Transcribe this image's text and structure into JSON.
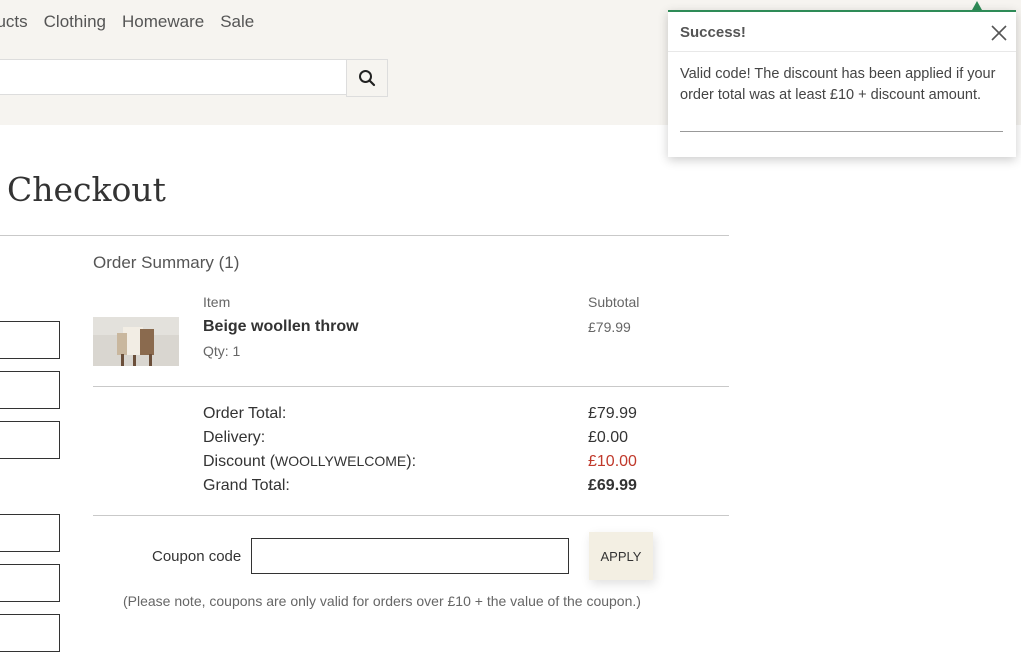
{
  "nav": {
    "items": [
      "ducts",
      "Clothing",
      "Homeware",
      "Sale"
    ]
  },
  "search": {
    "value": "",
    "icon": "search-icon"
  },
  "checkout": {
    "title": "Checkout"
  },
  "summary": {
    "title": "Order Summary (1)",
    "col_item": "Item",
    "col_subtotal": "Subtotal",
    "item": {
      "name": "Beige woollen throw",
      "qty": "Qty: 1",
      "subtotal": "£79.99"
    },
    "order_total_label": "Order Total:",
    "order_total": "£79.99",
    "delivery_label": "Delivery:",
    "delivery": "£0.00",
    "discount_label_prefix": "Discount (",
    "discount_code": "WOOLLYWELCOME",
    "discount_label_suffix": "):",
    "discount": "£10.00",
    "grand_total_label": "Grand Total:",
    "grand_total": "£69.99"
  },
  "coupon": {
    "label": "Coupon code",
    "value": "",
    "apply": "APPLY",
    "note": "(Please note, coupons are only valid for orders over £10 + the value of the coupon.)"
  },
  "toast": {
    "title": "Success!",
    "message": "Valid code! The discount has been applied if your order total was at least £10 + discount amount.",
    "accent": "#2e8b57"
  },
  "colors": {
    "discount": "#c0392b",
    "header_bg": "#f6f4f0",
    "apply_bg": "#f3efe3"
  }
}
